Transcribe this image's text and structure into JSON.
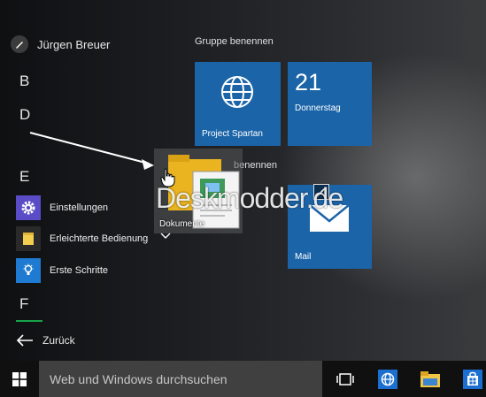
{
  "user": {
    "name": "Jürgen Breuer"
  },
  "letters": [
    "B",
    "D",
    "E",
    "F"
  ],
  "apps": [
    {
      "label": "Einstellungen",
      "icon": "gear-icon",
      "color": "#5a4bc6"
    },
    {
      "label": "Erleichterte Bedienung",
      "icon": "folder-icon",
      "color": "#2a2a2a"
    },
    {
      "label": "Erste Schritte",
      "icon": "lightbulb-icon",
      "color": "#1f7ad1"
    }
  ],
  "back_label": "Zurück",
  "groups": [
    {
      "title": "Gruppe benennen"
    },
    {
      "title": "benennen"
    }
  ],
  "tiles": {
    "spartan": {
      "label": "Project Spartan",
      "icon": "globe-icon"
    },
    "calendar": {
      "day": "21",
      "weekday": "Donnerstag"
    },
    "mail": {
      "label": "Mail",
      "icon": "envelope-icon"
    }
  },
  "drag_item": {
    "label": "Dokumente"
  },
  "watermark": "Deskmodder.de",
  "taskbar": {
    "search_placeholder": "Web und Windows durchsuchen",
    "buttons": [
      "task-view-icon",
      "internet-explorer-icon",
      "file-explorer-icon",
      "store-icon"
    ]
  },
  "colors": {
    "tile": "#1b64a8",
    "accent_green": "#17a34a",
    "taskbar": "#101010",
    "search": "#404040"
  }
}
